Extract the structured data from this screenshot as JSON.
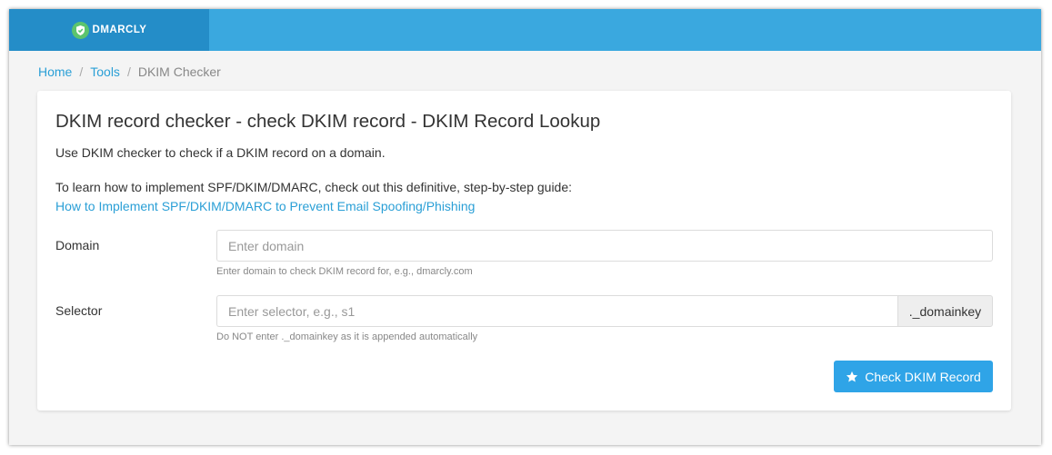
{
  "brand": {
    "name": "DMARCLY",
    "logo_icon": "shield-check-icon"
  },
  "breadcrumb": {
    "items": [
      "Home",
      "Tools"
    ],
    "current": "DKIM Checker",
    "separator": "/"
  },
  "page": {
    "title": "DKIM record checker - check DKIM record - DKIM Record Lookup",
    "intro": "Use DKIM checker to check if a DKIM record on a domain.",
    "guide_text": "To learn how to implement SPF/DKIM/DMARC, check out this definitive, step-by-step guide:",
    "guide_link": "How to Implement SPF/DKIM/DMARC to Prevent Email Spoofing/Phishing"
  },
  "form": {
    "domain": {
      "label": "Domain",
      "value": "",
      "placeholder": "Enter domain",
      "help": "Enter domain to check DKIM record for, e.g., dmarcly.com"
    },
    "selector": {
      "label": "Selector",
      "value": "",
      "placeholder": "Enter selector, e.g., s1",
      "addon": "._domainkey",
      "help": "Do NOT enter ._domainkey as it is appended automatically"
    },
    "submit": {
      "label": "Check DKIM Record",
      "icon": "star-icon"
    }
  },
  "colors": {
    "topbar": "#3aa8df",
    "brand_bg": "#248dc8",
    "link": "#2a9fd6",
    "button": "#2fa4e7"
  }
}
